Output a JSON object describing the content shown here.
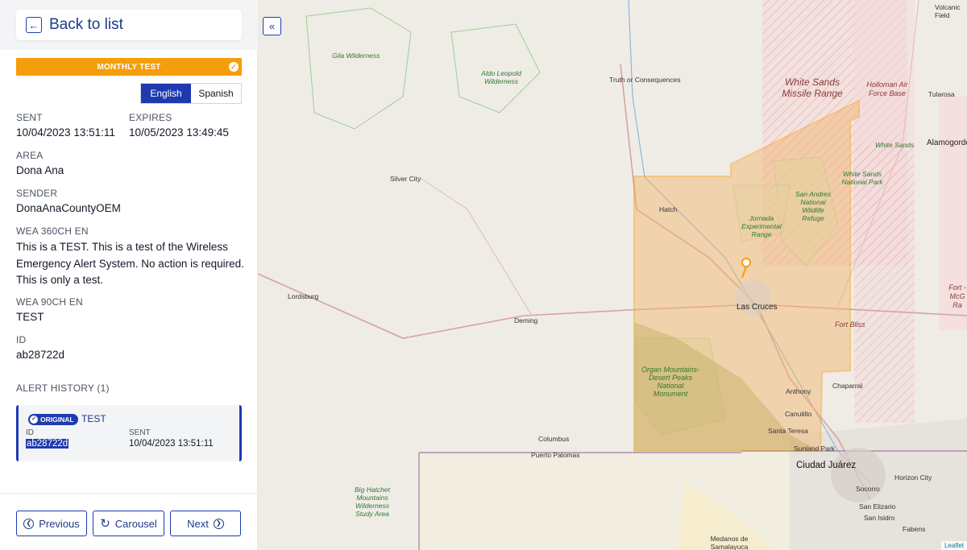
{
  "sidebar": {
    "back_label": "Back to list",
    "back_icon": "arrow-left-icon",
    "banner": {
      "label": "MONTHLY TEST",
      "color": "#f59e0b"
    },
    "languages": {
      "active": "English",
      "inactive": "Spanish"
    },
    "sent": {
      "label": "SENT",
      "value": "10/04/2023 13:51:11"
    },
    "expires": {
      "label": "EXPIRES",
      "value": "10/05/2023 13:49:45"
    },
    "area": {
      "label": "AREA",
      "value": "Dona Ana"
    },
    "sender": {
      "label": "SENDER",
      "value": "DonaAnaCountyOEM"
    },
    "wea360": {
      "label": "WEA 360CH EN",
      "value": "This is a TEST. This is a test of the Wireless Emergency Alert System. No action is required. This is only a test."
    },
    "wea90": {
      "label": "WEA 90CH EN",
      "value": "TEST"
    },
    "id": {
      "label": "ID",
      "value": "ab28722d"
    },
    "history": {
      "title": "ALERT HISTORY (1)",
      "items": [
        {
          "badge": "ORIGINAL",
          "type": "TEST",
          "id_label": "ID",
          "id": "ab28722d",
          "sent_label": "SENT",
          "sent": "10/04/2023 13:51:11"
        }
      ]
    },
    "footer": {
      "previous": "Previous",
      "carousel": "Carousel",
      "next": "Next"
    },
    "accent": "#1e3aaf"
  },
  "map": {
    "collapse_icon": "double-chevron-left-icon",
    "labels": {
      "gila": "Gila Wilderness",
      "aldo": "Aldo Leopold Wilderness",
      "toc": "Truth or Consequences",
      "wsmr": "White Sands Missile Range",
      "holloman": "Holloman Air Force Base",
      "tularosa": "Tularosa",
      "alamogordo": "Alamogordo",
      "whitesands": "White Sands",
      "wsnp": "White Sands National Park",
      "sanandres": "San Andres National Wildlife Refuge",
      "jornada": "Jornada Experimental Range",
      "silvercity": "Silver City",
      "hatch": "Hatch",
      "lordsburg": "Lordsburg",
      "deming": "Deming",
      "lascruces": "Las Cruces",
      "fortbliss": "Fort Bliss",
      "fortbliss2": "Fort - McG Ra",
      "organ": "Organ Mountains-Desert Peaks National Monument",
      "chaparral": "Chaparral",
      "anthony": "Anthony",
      "canutillo": "Canutillo",
      "santateresa": "Santa Teresa",
      "sunland": "Sunland Park",
      "juarez": "Ciudad Juárez",
      "columbus": "Columbus",
      "palomas": "Puerto Palomas",
      "bighatchet": "Big Hatchet Mountains Wilderness Study Area",
      "horizon": "Horizon City",
      "socorro": "Socorro",
      "sanelizario": "San Elizario",
      "sanisidro": "San Isidro",
      "fabens": "Fabens",
      "medanos": "Medanos de Samalayuca",
      "volcanic": "Volcanic Field"
    },
    "alert_area_color": "#f59e0b",
    "attribution": "Leaflet"
  }
}
